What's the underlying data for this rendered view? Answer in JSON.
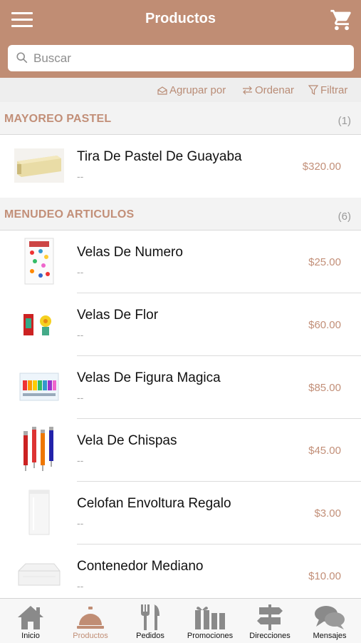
{
  "header": {
    "title": "Productos"
  },
  "search": {
    "placeholder": "Buscar"
  },
  "toolbar": {
    "group_label": "Agrupar por",
    "sort_label": "Ordenar",
    "filter_label": "Filtrar"
  },
  "sections": [
    {
      "name": "MAYOREO PASTEL",
      "count": "(1)",
      "items": [
        {
          "name": "Tira De Pastel De Guayaba",
          "sub": "--",
          "price": "$320.00"
        }
      ]
    },
    {
      "name": "MENUDEO ARTICULOS",
      "count": "(6)",
      "items": [
        {
          "name": "Velas De Numero",
          "sub": "--",
          "price": "$25.00"
        },
        {
          "name": "Velas De Flor",
          "sub": "--",
          "price": "$60.00"
        },
        {
          "name": "Velas De Figura Magica",
          "sub": "--",
          "price": "$85.00"
        },
        {
          "name": "Vela De Chispas",
          "sub": "--",
          "price": "$45.00"
        },
        {
          "name": "Celofan Envoltura Regalo",
          "sub": "--",
          "price": "$3.00"
        },
        {
          "name": "Contenedor Mediano",
          "sub": "--",
          "price": "$10.00"
        }
      ]
    }
  ],
  "tabs": [
    {
      "label": "Inicio",
      "icon": "home-icon",
      "active": false
    },
    {
      "label": "Productos",
      "icon": "service-bell-icon",
      "active": true
    },
    {
      "label": "Pedidos",
      "icon": "fork-knife-icon",
      "active": false
    },
    {
      "label": "Promociones",
      "icon": "gift-icon",
      "active": false
    },
    {
      "label": "Direcciones",
      "icon": "signpost-icon",
      "active": false
    },
    {
      "label": "Mensajes",
      "icon": "chat-bubbles-icon",
      "active": false
    }
  ],
  "colors": {
    "brand": "#c08d74",
    "price": "#c28f78",
    "section_bg": "#f3f3f3"
  }
}
